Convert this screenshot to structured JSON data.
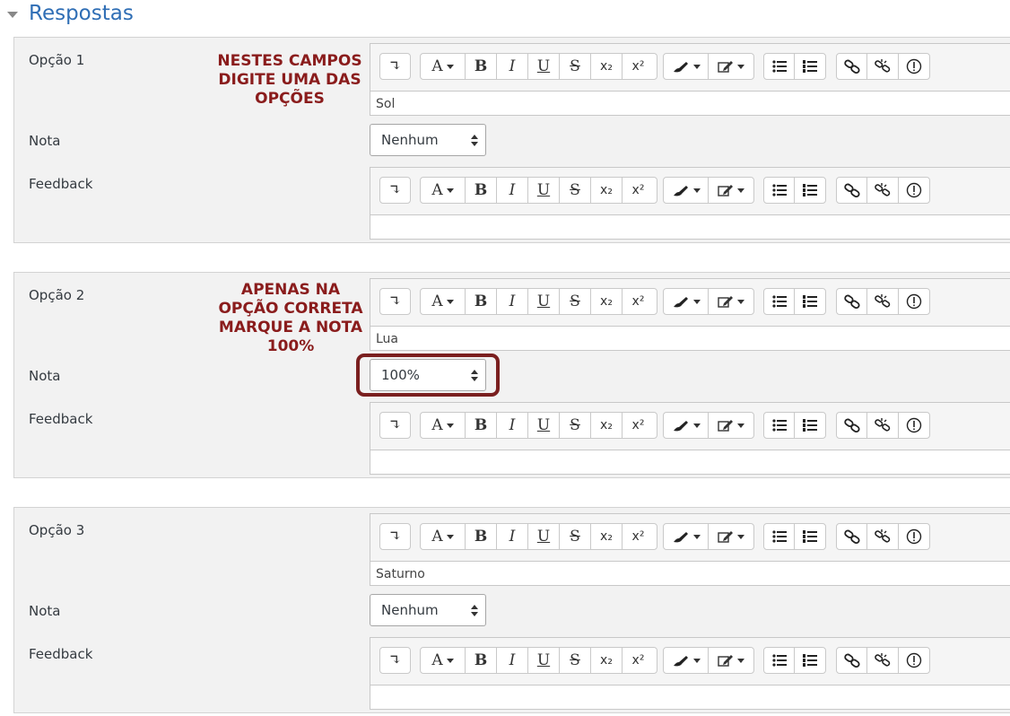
{
  "section": {
    "title": "Respostas"
  },
  "labels": {
    "nota": "Nota",
    "feedback": "Feedback"
  },
  "toolbar": {
    "expand_glyph": "↴",
    "font_glyph": "A",
    "bold": "B",
    "italic": "I",
    "underline": "U",
    "strike": "S",
    "subscript": "x₂",
    "superscript": "x²"
  },
  "options": [
    {
      "label": "Opção 1",
      "answer": "Sol",
      "grade": "Nenhum",
      "feedback": ""
    },
    {
      "label": "Opção 2",
      "answer": "Lua",
      "grade": "100%",
      "feedback": ""
    },
    {
      "label": "Opção 3",
      "answer": "Saturno",
      "grade": "Nenhum",
      "feedback": ""
    }
  ],
  "annotations": {
    "first": [
      "NESTES CAMPOS",
      "DIGITE UMA DAS",
      "OPÇÕES"
    ],
    "second": [
      "APENAS NA",
      "OPÇÃO CORRETA",
      "MARQUE A NOTA",
      "100%"
    ]
  },
  "colors": {
    "title": "#2f6eb5",
    "annotation": "#8a1c1c",
    "highlight": "#7a1f1f"
  }
}
